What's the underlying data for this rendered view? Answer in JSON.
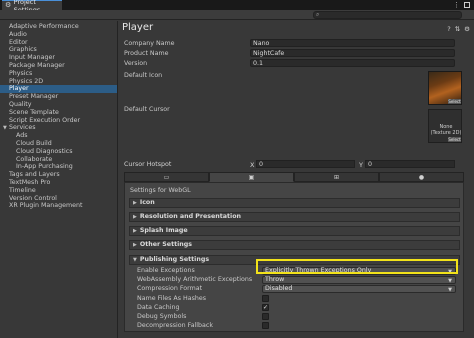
{
  "window": {
    "tab_title": "Project Settings",
    "menu_glyph": "⋮",
    "search_placeholder": "",
    "search_glyph": "⌕"
  },
  "sidebar": {
    "items": [
      {
        "label": "Adaptive Performance",
        "level": 0
      },
      {
        "label": "Audio",
        "level": 0
      },
      {
        "label": "Editor",
        "level": 0
      },
      {
        "label": "Graphics",
        "level": 0
      },
      {
        "label": "Input Manager",
        "level": 0
      },
      {
        "label": "Package Manager",
        "level": 0
      },
      {
        "label": "Physics",
        "level": 0
      },
      {
        "label": "Physics 2D",
        "level": 0
      },
      {
        "label": "Player",
        "level": 0,
        "selected": true
      },
      {
        "label": "Preset Manager",
        "level": 0
      },
      {
        "label": "Quality",
        "level": 0
      },
      {
        "label": "Scene Template",
        "level": 0
      },
      {
        "label": "Script Execution Order",
        "level": 0
      },
      {
        "label": "Services",
        "level": 0,
        "expanded": true
      },
      {
        "label": "Ads",
        "level": 1
      },
      {
        "label": "Cloud Build",
        "level": 1
      },
      {
        "label": "Cloud Diagnostics",
        "level": 1
      },
      {
        "label": "Collaborate",
        "level": 1
      },
      {
        "label": "In-App Purchasing",
        "level": 1
      },
      {
        "label": "Tags and Layers",
        "level": 0
      },
      {
        "label": "TextMesh Pro",
        "level": 0
      },
      {
        "label": "Timeline",
        "level": 0
      },
      {
        "label": "Version Control",
        "level": 0
      },
      {
        "label": "XR Plugin Management",
        "level": 0
      }
    ]
  },
  "player": {
    "title": "Player",
    "header_icons": [
      "?",
      "⇅",
      "⚙"
    ],
    "company_name_label": "Company Name",
    "company_name_value": "Nano",
    "product_name_label": "Product Name",
    "product_name_value": "NightCafe",
    "version_label": "Version",
    "version_value": "0.1",
    "default_icon_label": "Default Icon",
    "default_cursor_label": "Default Cursor",
    "select_label": "Select",
    "none_texture": "None\n(Texture 2D)",
    "cursor_hotspot_label": "Cursor Hotspot",
    "hotspot_x_label": "X",
    "hotspot_x_value": "0",
    "hotspot_y_label": "Y",
    "hotspot_y_value": "0"
  },
  "platform_tabs": [
    {
      "icon": "monitor-icon",
      "glyph": "▭",
      "active": false
    },
    {
      "icon": "webgl-icon",
      "glyph": "▣",
      "active": true
    },
    {
      "icon": "windows-icon",
      "glyph": "⊞",
      "active": false
    },
    {
      "icon": "android-icon",
      "glyph": "●",
      "active": false
    }
  ],
  "settings": {
    "settings_for": "Settings for WebGL",
    "foldouts": [
      "Icon",
      "Resolution and Presentation",
      "Splash Image",
      "Other Settings"
    ],
    "publishing": {
      "title": "Publishing Settings",
      "enable_exceptions_label": "Enable Exceptions",
      "enable_exceptions_value": "Explicitly Thrown Exceptions Only",
      "wasm_exceptions_label": "WebAssembly Arithmetic Exceptions",
      "wasm_exceptions_value": "Throw",
      "compression_label": "Compression Format",
      "compression_value": "Disabled",
      "name_hashes_label": "Name Files As Hashes",
      "name_hashes_checked": false,
      "data_caching_label": "Data Caching",
      "data_caching_checked": true,
      "debug_symbols_label": "Debug Symbols",
      "debug_symbols_checked": false,
      "decompression_label": "Decompression Fallback",
      "decompression_checked": false
    }
  },
  "colors": {
    "selection": "#2c5d87",
    "highlight": "#f2e21a",
    "panel": "#383838"
  }
}
